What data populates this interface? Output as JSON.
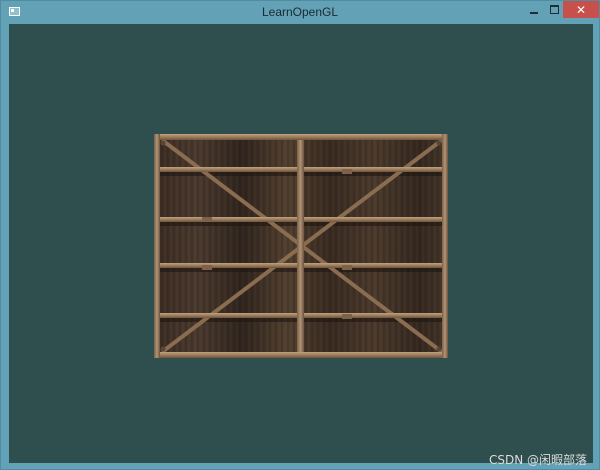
{
  "window": {
    "title": "LearnOpenGL",
    "icon": "app-window-icon",
    "controls": {
      "minimize": "minimize-icon",
      "maximize": "maximize-icon",
      "close": "close-icon",
      "close_label": "✕"
    }
  },
  "viewport": {
    "clear_color": "#2f4e4e",
    "texture": "wooden-container-texture"
  },
  "watermark": {
    "text": "CSDN @闲暇部落"
  }
}
